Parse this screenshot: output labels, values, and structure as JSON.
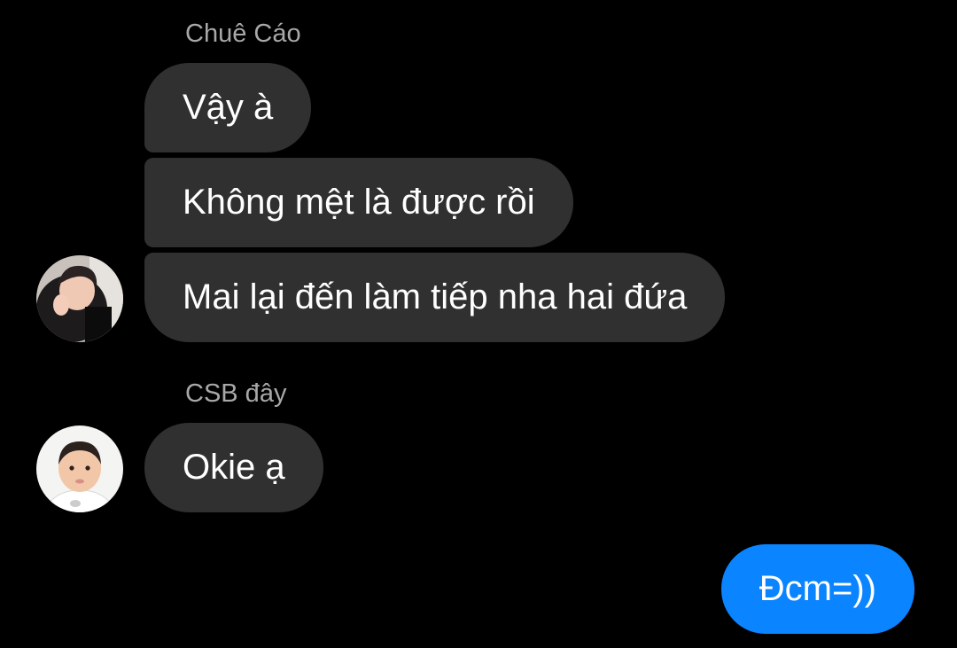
{
  "conversation": {
    "group1": {
      "sender": "Chuê Cáo",
      "messages": [
        "Vậy à",
        "Không mệt là được rồi",
        "Mai lại đến làm tiếp nha hai đứa"
      ]
    },
    "group2": {
      "sender": "CSB đây",
      "messages": [
        "Okie ạ"
      ]
    },
    "outgoing": {
      "messages": [
        "Đcm=))"
      ]
    }
  },
  "colors": {
    "background": "#000000",
    "incoming_bubble": "#303030",
    "outgoing_bubble": "#0a84ff",
    "sender_name": "#a8a8a8",
    "message_text": "#ffffff"
  },
  "icons": {
    "avatar1": "user-photo-avatar",
    "avatar2": "child-photo-avatar"
  }
}
